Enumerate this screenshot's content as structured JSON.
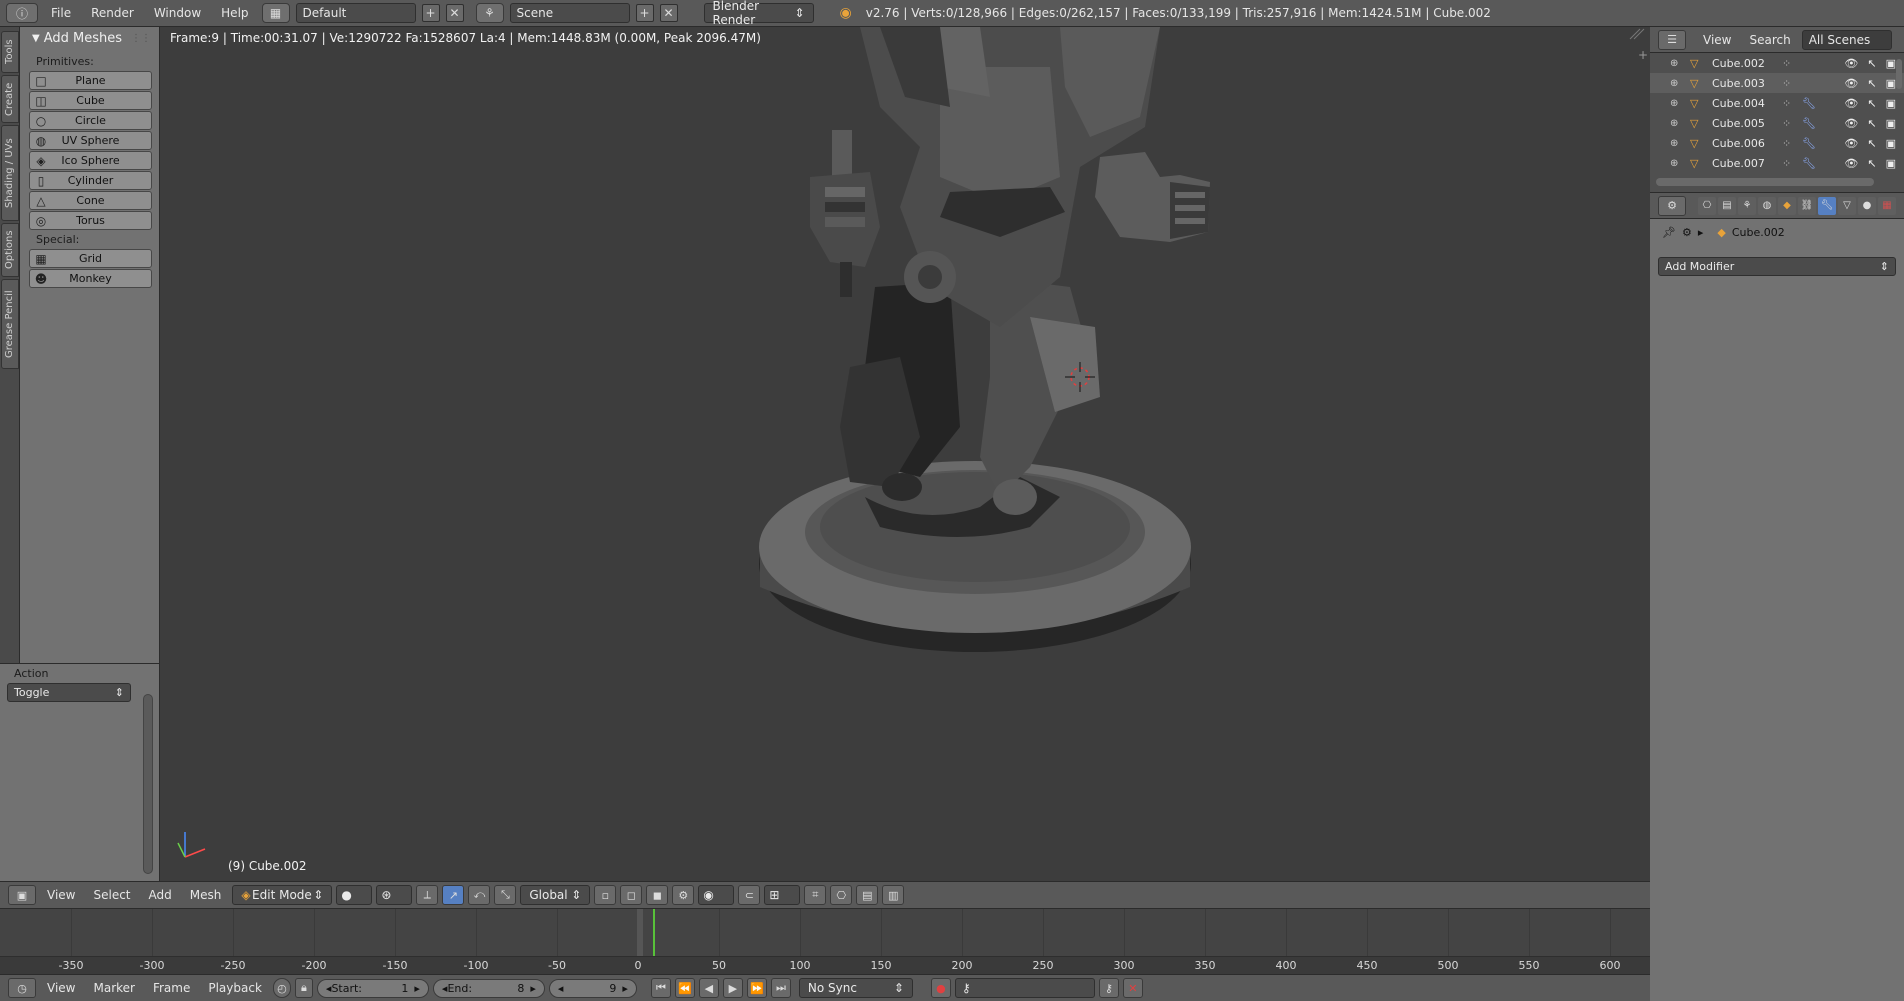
{
  "topbar": {
    "menus": [
      "File",
      "Render",
      "Window",
      "Help"
    ],
    "layout": "Default",
    "scene": "Scene",
    "engine": "Blender Render",
    "stats": "v2.76 | Verts:0/128,966 | Edges:0/262,157 | Faces:0/133,199 | Tris:257,916 | Mem:1424.51M | Cube.002"
  },
  "lefttabs": [
    "Tools",
    "Create",
    "Shading / UVs",
    "Options",
    "Grease Pencil"
  ],
  "toolshelf": {
    "title": "Add Meshes",
    "primitives_label": "Primitives:",
    "primitives": [
      "Plane",
      "Cube",
      "Circle",
      "UV Sphere",
      "Ico Sphere",
      "Cylinder",
      "Cone",
      "Torus"
    ],
    "special_label": "Special:",
    "special": [
      "Grid",
      "Monkey"
    ]
  },
  "action": {
    "label": "Action",
    "value": "Toggle"
  },
  "viewport": {
    "info": "Frame:9 | Time:00:31.07 | Ve:1290722 Fa:1528607 La:4 | Mem:1448.83M (0.00M, Peak 2096.47M)",
    "object_label": "(9) Cube.002"
  },
  "view3d_header": {
    "menus": [
      "View",
      "Select",
      "Add",
      "Mesh"
    ],
    "mode": "Edit Mode",
    "orientation": "Global"
  },
  "timeline": {
    "ticks": [
      -350,
      -300,
      -250,
      -200,
      -150,
      -100,
      -50,
      0,
      50,
      100,
      150,
      200,
      250,
      300,
      350,
      400,
      450,
      500,
      550,
      600
    ],
    "current_frame": 9
  },
  "timeline_header": {
    "menus": [
      "View",
      "Marker",
      "Frame",
      "Playback"
    ],
    "start_label": "Start:",
    "start": "1",
    "end_label": "End:",
    "end": "8",
    "current": "9",
    "sync": "No Sync"
  },
  "outliner": {
    "menus": [
      "View",
      "Search"
    ],
    "scene_filter": "All Scenes",
    "items": [
      "Cube.002",
      "Cube.003",
      "Cube.004",
      "Cube.005",
      "Cube.006",
      "Cube.007"
    ]
  },
  "properties": {
    "context_object": "Cube.002",
    "add_modifier": "Add Modifier"
  },
  "colors": {
    "accent_blue": "#5680c2",
    "frame_cursor": "#58c23a",
    "mesh_orange": "#e8a33a"
  }
}
